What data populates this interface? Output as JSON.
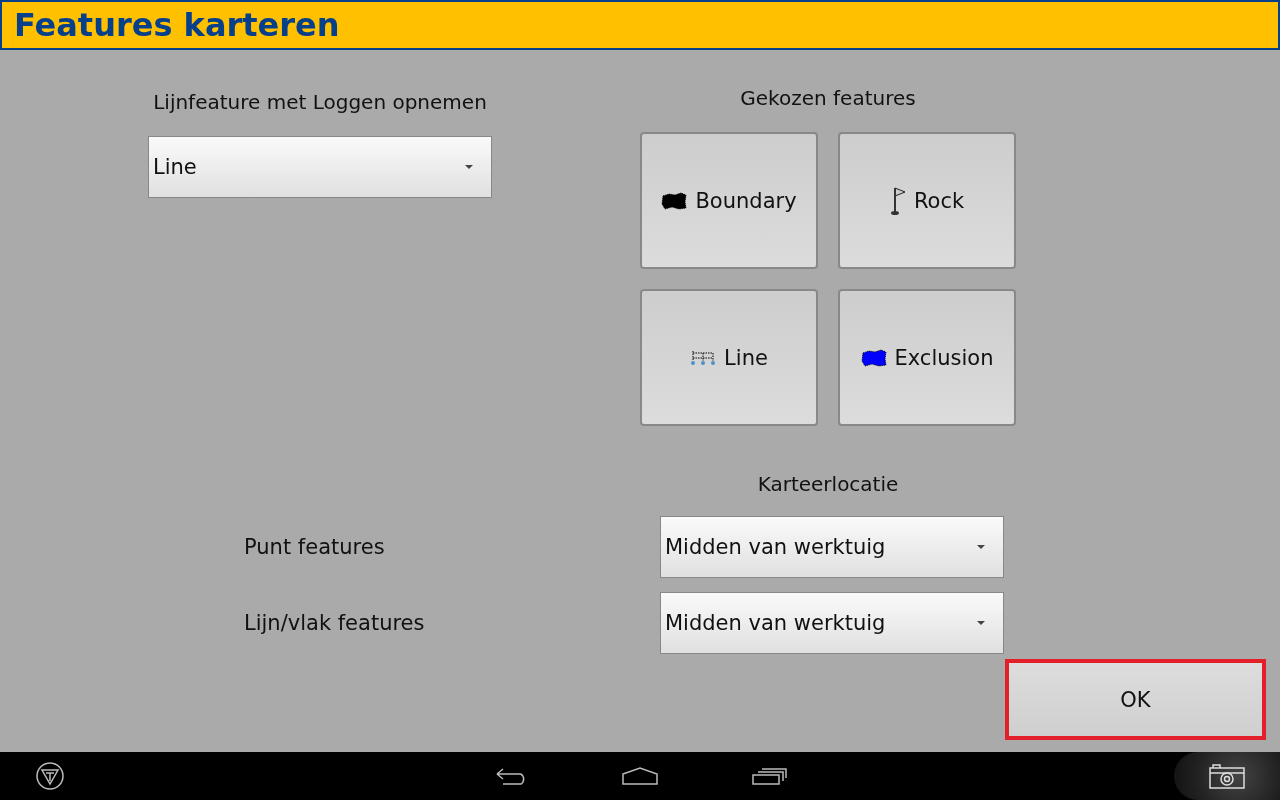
{
  "window": {
    "title": "Features karteren"
  },
  "line_logging": {
    "label": "Lijnfeature met Loggen opnemen",
    "value": "Line"
  },
  "chosen_features": {
    "label": "Gekozen features",
    "items": [
      {
        "label": "Boundary",
        "kind": "area",
        "color": "#000000"
      },
      {
        "label": "Rock",
        "kind": "flag"
      },
      {
        "label": "Line",
        "kind": "line"
      },
      {
        "label": "Exclusion",
        "kind": "area",
        "color": "#0000ff"
      }
    ]
  },
  "mapping_location": {
    "label": "Karteerlocatie",
    "rows": [
      {
        "label": "Punt features",
        "value": "Midden van werktuig"
      },
      {
        "label": "Lijn/vlak features",
        "value": "Midden van werktuig"
      }
    ]
  },
  "ok_button": {
    "label": "OK"
  }
}
